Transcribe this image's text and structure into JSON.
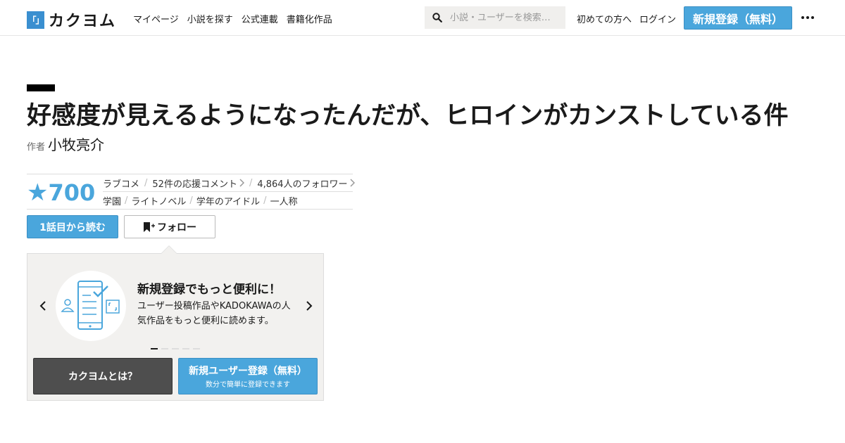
{
  "header": {
    "logo_mark": "「」",
    "logo_text": "カクヨム",
    "nav": [
      "マイページ",
      "小説を探す",
      "公式連載",
      "書籍化作品"
    ],
    "search_placeholder": "小説・ユーザーを検索…",
    "first_time": "初めての方へ",
    "login": "ログイン",
    "register": "新規登録（無料）"
  },
  "work": {
    "title": "好感度が見えるようになったんだが、ヒロインがカンストしている件",
    "author_label": "作者",
    "author": "小牧亮介",
    "star_icon": "★",
    "stars": "700",
    "genre": "ラブコメ",
    "comments": "52件の応援コメント",
    "followers": "4,864人のフォロワー",
    "tags": [
      "学園",
      "ライトノベル",
      "学年のアイドル",
      "一人称"
    ]
  },
  "actions": {
    "read_first": "1話目から読む",
    "follow": "フォロー"
  },
  "promo": {
    "heading": "新規登録でもっと便利に！",
    "body": "ユーザー投稿作品やKADOKAWAの人気作品をもっと便利に読めます。",
    "about": "カクヨムとは？",
    "signup": "新規ユーザー登録（無料）",
    "signup_sub": "数分で簡単に登録できます"
  },
  "colors": {
    "accent": "#4aa6dc",
    "logo": "#3a8fd0",
    "dark_button": "#4e4e4e",
    "promo_bg": "#f2f1ef"
  },
  "icons": [
    "logo-icon",
    "search-icon",
    "more-icon",
    "star-icon",
    "chevron-right-icon",
    "bookmark-plus-icon",
    "chevron-left-icon",
    "smartphone-illustration"
  ]
}
